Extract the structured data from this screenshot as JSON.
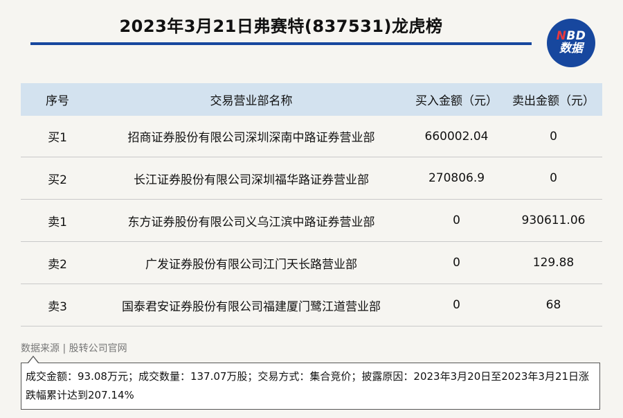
{
  "title": "2023年3月21日弗赛特(837531)龙虎榜",
  "logo": {
    "line1_accent": "N",
    "line1_rest": "BD",
    "line2": "数据"
  },
  "table": {
    "headers": [
      "序号",
      "交易营业部名称",
      "买入金额（元）",
      "卖出金额（元）"
    ],
    "rows": [
      [
        "买1",
        "招商证券股份有限公司深圳深南中路证券营业部",
        "660002.04",
        "0"
      ],
      [
        "买2",
        "长江证券股份有限公司深圳福华路证券营业部",
        "270806.9",
        "0"
      ],
      [
        "卖1",
        "东方证券股份有限公司义乌江滨中路证券营业部",
        "0",
        "930611.06"
      ],
      [
        "卖2",
        "广发证券股份有限公司江门天长路营业部",
        "0",
        "129.88"
      ],
      [
        "卖3",
        "国泰君安证券股份有限公司福建厦门鹭江道营业部",
        "0",
        "68"
      ]
    ]
  },
  "source": "数据来源 | 股转公司官网",
  "note": "成交金额：93.08万元；成交数量：137.07万股；交易方式：集合竞价；披露原因：2023年3月20日至2023年3月21日涨跌幅累计达到207.14%",
  "colors": {
    "brand": "#17479e",
    "header_bg": "#d3e2ef",
    "accent": "#e8383d"
  }
}
